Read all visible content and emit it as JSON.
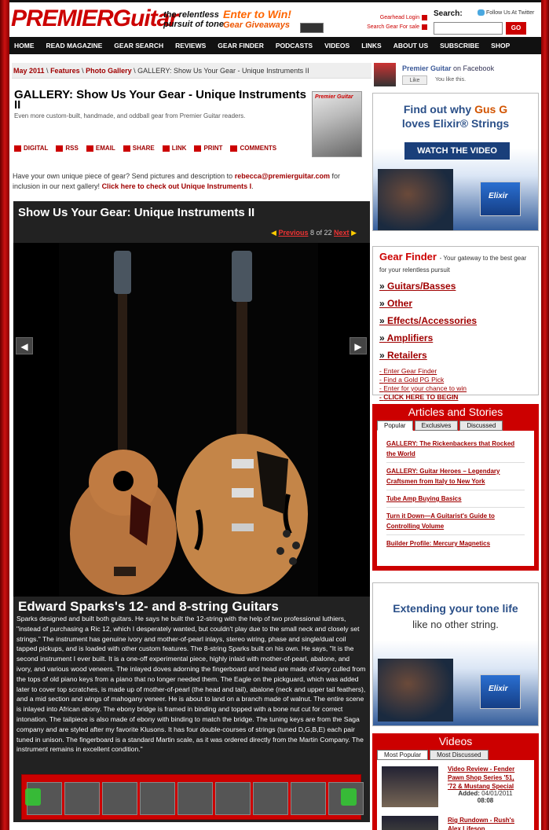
{
  "header": {
    "logo": "PREMIERGuitar",
    "tagline": "the relentless pursuit of tone",
    "promo_title": "Enter to Win!",
    "promo_sub": "Gear Giveaways",
    "gearhead_login": "Gearhead Login",
    "search_gear": "Search Gear For sale",
    "search_label": "Search:",
    "follow_twitter": "Follow Us At Twitter",
    "search_placeholder": "",
    "go_label": "GO"
  },
  "nav": [
    "HOME",
    "READ MAGAZINE",
    "GEAR SEARCH",
    "REVIEWS",
    "GEAR FINDER",
    "PODCASTS",
    "VIDEOS",
    "LINKS",
    "ABOUT US",
    "SUBSCRIBE",
    "SHOP"
  ],
  "breadcrumb": {
    "c1": "May 2011",
    "sep": " \\ ",
    "c2": "Features",
    "c3": "Photo Gallery",
    "current": "GALLERY: Show Us Your Gear - Unique Instruments II"
  },
  "article": {
    "title": "GALLERY: Show Us Your Gear - Unique Instruments II",
    "subtitle": "Even more custom-built, handmade, and oddball gear from Premier Guitar readers.",
    "cover_logo": "Premier Guitar",
    "share": [
      "DIGITAL",
      "RSS",
      "EMAIL",
      "SHARE",
      "LINK",
      "PRINT",
      "COMMENTS"
    ],
    "intro_pre": "Have your own unique piece of gear? Send pictures and description to ",
    "intro_email": "rebecca@premierguitar.com",
    "intro_mid": " for inclusion in our next gallery! ",
    "intro_link": "Click here to check out Unique Instruments I",
    "intro_end": "."
  },
  "gallery": {
    "title": "Show Us Your Gear: Unique Instruments II",
    "prev": "Previous",
    "position": "8 of 22",
    "next": "Next",
    "caption_title": "Edward Sparks's 12- and 8-string Guitars",
    "caption": "Sparks designed and built both guitars. He says he built the 12-string with the help of two professional luthiers, \"instead of purchasing a Ric 12, which I desperately wanted, but couldn't play due to the small neck and closely set strings.\" The instrument has genuine ivory and mother-of-pearl inlays, stereo wiring, phase and single/dual coil tapped pickups, and is loaded with other custom features. The 8-string Sparks built on his own. He says, \"It is the second instrument I ever built. It is a one-off experimental piece, highly inlaid with mother-of-pearl, abalone, and ivory, and various wood veneers. The inlayed doves adorning the fingerboard and head are made of ivory culled from the tops of old piano keys from a piano that no longer needed them. The Eagle on the pickguard, which was added later to cover top scratches, is made up of mother-of-pearl (the head and tail), abalone (neck and upper tail feathers), and a mid section and wings of mahogany veneer. He is about to land on a branch made of walnut. The entire scene is inlayed into African ebony. The ebony bridge is framed in binding and topped with a bone nut cut for correct intonation. The tailpiece is also made of ebony with binding to match the bridge. The tuning keys are from the Saga company and are styled after my favorite Klusons. It has four double-courses of strings (tuned D,G,B,E) each pair tuned in unison. The fingerboard is a standard Martin scale, as it was ordered directly from the Martin Company. The instrument remains in excellent condition.\""
  },
  "sidebar": {
    "fb_name": "Premier Guitar",
    "fb_on": " on Facebook",
    "fb_like": "Like",
    "fb_you_like": "You like this.",
    "ad1_line1_a": "Find out why ",
    "ad1_line1_b": "Gus G",
    "ad1_line2": "loves Elixir® Strings",
    "ad1_button": "WATCH THE VIDEO",
    "pack_label": "Elixir",
    "gearfinder_title": "Gear Finder",
    "gearfinder_desc": "- Your gateway to the best gear for your relentless pursuit",
    "gearfinder_items": [
      "Guitars/Basses",
      "Other",
      "Effects/Accessories",
      "Amplifiers",
      "Retailers"
    ],
    "gearfinder_links": [
      "Enter Gear Finder",
      "Find a Gold PG Pick",
      "Enter for your chance to win",
      "CLICK HERE TO BEGIN"
    ],
    "articles_title": "Articles and Stories",
    "articles_tabs": [
      "Popular",
      "Exclusives",
      "Discussed"
    ],
    "articles": [
      "GALLERY: The Rickenbackers that Rocked the World",
      "GALLERY: Guitar Heroes – Legendary Craftsmen from Italy to New York",
      "Tube Amp Buying Basics",
      "Turn it Down—A Guitarist's Guide to Controlling Volume",
      "Builder Profile: Mercury Magnetics"
    ],
    "ad2_line1": "Extending your tone life",
    "ad2_line2": "like no other string.",
    "videos_title": "Videos",
    "videos_tabs": [
      "Most Popular",
      "Most Discussed"
    ],
    "video1_title": "Video Review - Fender Pawn Shop Series '51, '72 & Mustang Special",
    "video1_added_label": "Added:",
    "video1_date": "04/01/2011",
    "video1_time": "08:08",
    "video2_title": "Rig Rundown - Rush's Alex Lifeson"
  },
  "colors": {
    "brand_red": "#cc0000",
    "nav_bg": "#111111",
    "link": "#a00000"
  }
}
